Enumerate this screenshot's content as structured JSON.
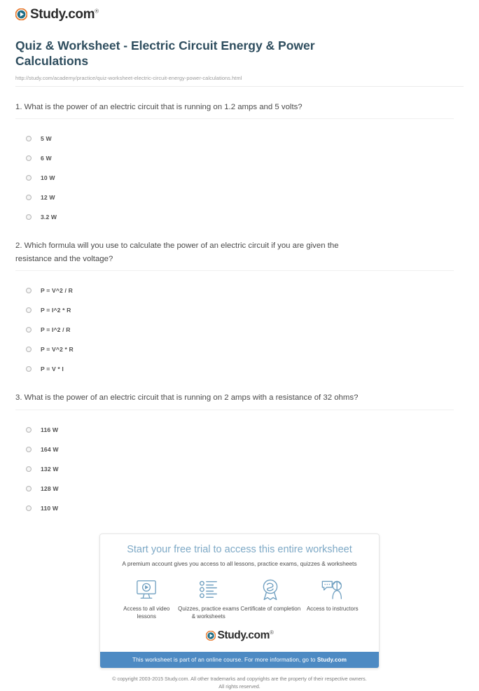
{
  "brand": {
    "name": "Study.com",
    "trademark": "®",
    "mark_icon": "play-circle-icon",
    "mark_outer_color": "#e8772a",
    "mark_inner_color": "#1f6d86"
  },
  "header": {
    "title": "Quiz & Worksheet - Electric Circuit Energy & Power Calculations",
    "url": "http://study.com/academy/practice/quiz-worksheet-electric-circuit-energy-power-calculations.html",
    "title_color": "#2e4d5e"
  },
  "questions": [
    {
      "number": "1.",
      "text": "1. What is the power of an electric circuit that is running on 1.2 amps and 5 volts?",
      "options": [
        "5 W",
        "6 W",
        "10 W",
        "12 W",
        "3.2 W"
      ]
    },
    {
      "number": "2.",
      "text": "2. Which formula will you use to calculate the power of an electric circuit if you are given the resistance and the voltage?",
      "options": [
        "P = V^2 / R",
        "P = I^2 * R",
        "P = I^2 / R",
        "P = V^2 * R",
        "P = V * I"
      ]
    },
    {
      "number": "3.",
      "text": "3. What is the power of an electric circuit that is running on 2 amps with a resistance of 32 ohms?",
      "options": [
        "116 W",
        "164 W",
        "132 W",
        "128 W",
        "110 W"
      ]
    }
  ],
  "promo": {
    "headline": "Start your free trial to access this entire worksheet",
    "subhead": "A premium account gives you access to all lessons, practice exams, quizzes & worksheets",
    "headline_color": "#7ea9c6",
    "bar_color": "#4d8ac3",
    "benefits": [
      {
        "icon": "monitor-play-icon",
        "label": "Access to all video lessons"
      },
      {
        "icon": "checklist-icon",
        "label": "Quizzes, practice exams & worksheets"
      },
      {
        "icon": "award-ribbon-icon",
        "label": "Certificate of completion"
      },
      {
        "icon": "instructor-chat-icon",
        "label": "Access to instructors"
      }
    ],
    "bar_text_prefix": "This worksheet is part of an online course. For more information, go to ",
    "bar_link_text": "Study.com"
  },
  "footer": {
    "line1": "© copyright 2003-2015 Study.com. All other trademarks and copyrights are the property of their respective owners.",
    "line2": "All rights reserved."
  }
}
